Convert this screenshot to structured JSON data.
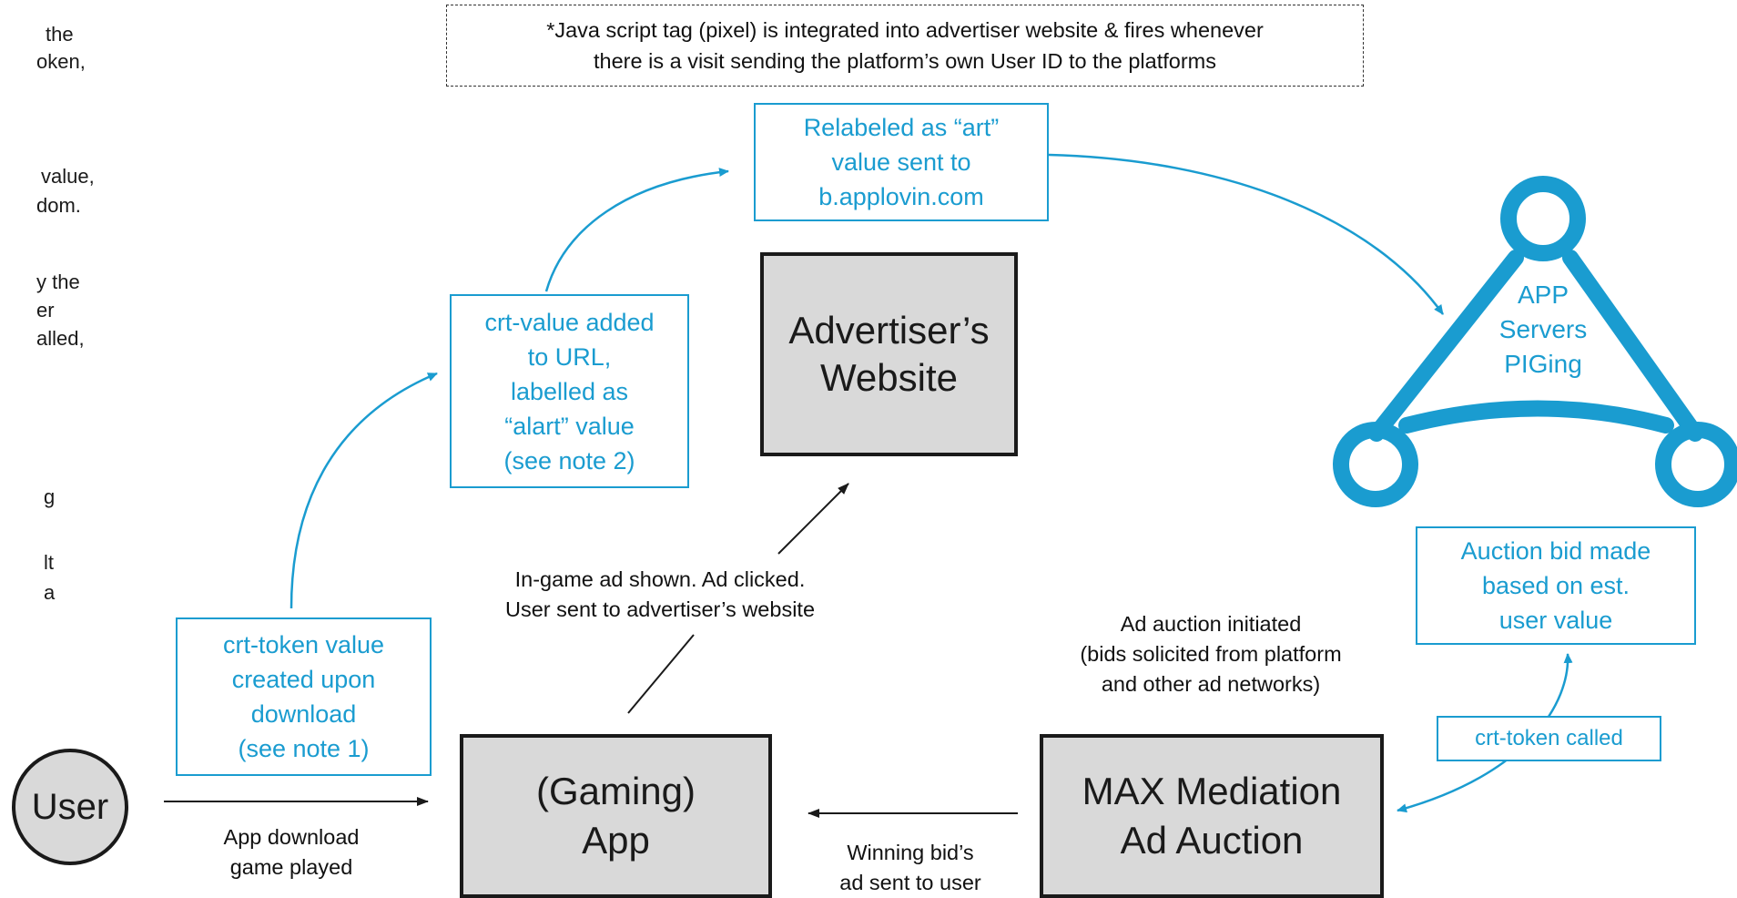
{
  "left_notes": [
    "the",
    "oken,",
    "value,",
    "dom.",
    "y the",
    "er",
    "alled,",
    "g",
    "lt",
    "a"
  ],
  "header_note": {
    "line1": "*Java script tag (pixel) is integrated into advertiser website & fires whenever",
    "line2": "there is a visit sending the platform’s own User ID to the platforms"
  },
  "blue_boxes": {
    "relabeled": [
      "Relabeled as “art”",
      "value sent to",
      "b.applovin.com"
    ],
    "crt_value": [
      "crt-value added",
      "to URL,",
      "labelled as",
      "“alart” value",
      "(see note 2)"
    ],
    "crt_token_created": [
      "crt-token value",
      "created upon",
      "download",
      "(see note 1)"
    ],
    "auction_bid": [
      "Auction bid made",
      "based on est.",
      "user value"
    ],
    "crt_token_called": "crt-token called"
  },
  "gray_boxes": {
    "advertiser": [
      "Advertiser’s",
      "Website"
    ],
    "gaming_app": [
      "(Gaming)",
      "App"
    ],
    "max": [
      "MAX Mediation",
      "Ad Auction"
    ]
  },
  "user_label": "User",
  "triangle_label": [
    "APP",
    "Servers",
    "PIGing"
  ],
  "black_labels": {
    "in_game": [
      "In-game ad shown. Ad clicked.",
      "User sent to advertiser’s website"
    ],
    "auction_initiated": [
      "Ad auction initiated",
      "(bids solicited from platform",
      "and other ad networks)"
    ],
    "app_download": [
      "App download",
      "game played"
    ],
    "winning_bid": [
      "Winning bid’s",
      "ad sent to user"
    ]
  },
  "colors": {
    "blue": "#1a9cd0",
    "gray_fill": "#d9d9d9",
    "dark": "#1a1a1a"
  }
}
